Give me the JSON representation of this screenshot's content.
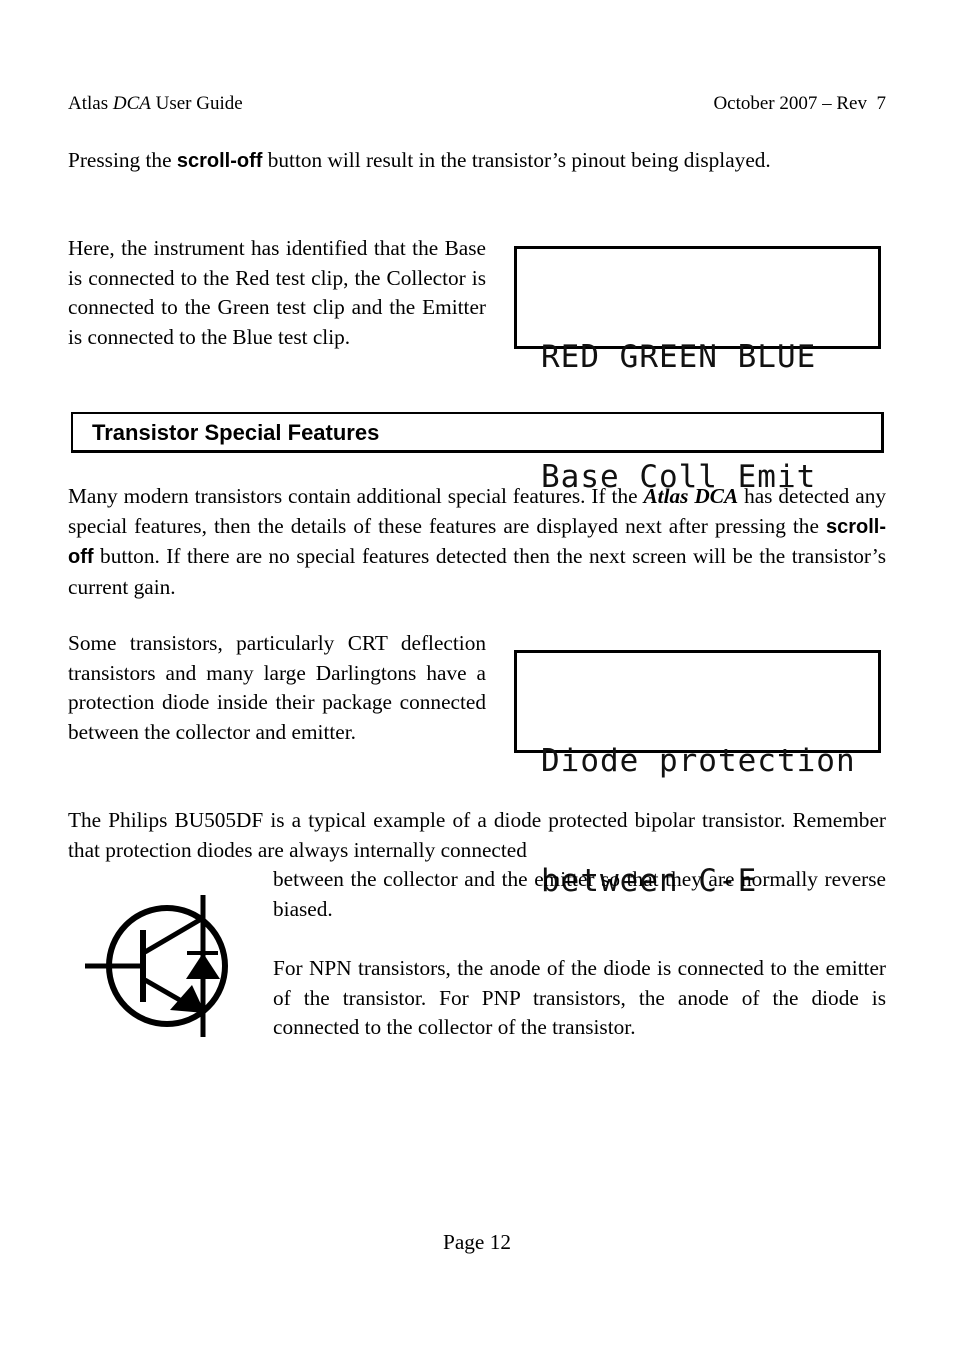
{
  "header": {
    "title_prefix": "Atlas ",
    "title_italic": "DCA",
    "title_suffix": " User Guide",
    "revision": "October 2007 – Rev  7"
  },
  "para1": {
    "before": "Pressing the ",
    "button": "scroll-off",
    "after": " button will result in the transistor’s pinout being displayed."
  },
  "para2": {
    "text": "Here, the instrument has identified that the Base is connected to the Red test clip, the Collector is connected to the Green test clip and the Emitter is connected to the Blue test clip."
  },
  "lcd1": {
    "line1": "RED GREEN BLUE",
    "line2": "Base Coll Emit"
  },
  "section": {
    "title": "Transistor Special Features"
  },
  "para3": {
    "before": "Many modern transistors contain additional special features. If the ",
    "brand": "Atlas DCA",
    "middle": " has detected any special features, then the details of these features are displayed next after pressing the ",
    "button": "scroll-off",
    "after": " button. If there are no special features detected then the next screen will be the transistor’s current gain."
  },
  "para4": {
    "text": "Some transistors, particularly CRT deflection transistors and many large Darlingtons have a protection diode inside their package connected between the collector and emitter."
  },
  "lcd2": {
    "line1": "Diode protection",
    "line2": "between C-E"
  },
  "para5": {
    "line_full": "The Philips BU505DF is a typical example of a diode protected bipolar transistor. Remember that protection diodes are always internally connected",
    "line_indented": "between the collector and the emitter so that they are normally reverse biased."
  },
  "para6": {
    "text": "For NPN transistors, the anode of the diode is connected to the emitter of the transistor. For PNP transistors, the anode of the diode is connected to the collector of the transistor."
  },
  "figure": {
    "icon": "npn-transistor-with-protection-diode-symbol"
  },
  "footer": {
    "page": "Page 12"
  }
}
